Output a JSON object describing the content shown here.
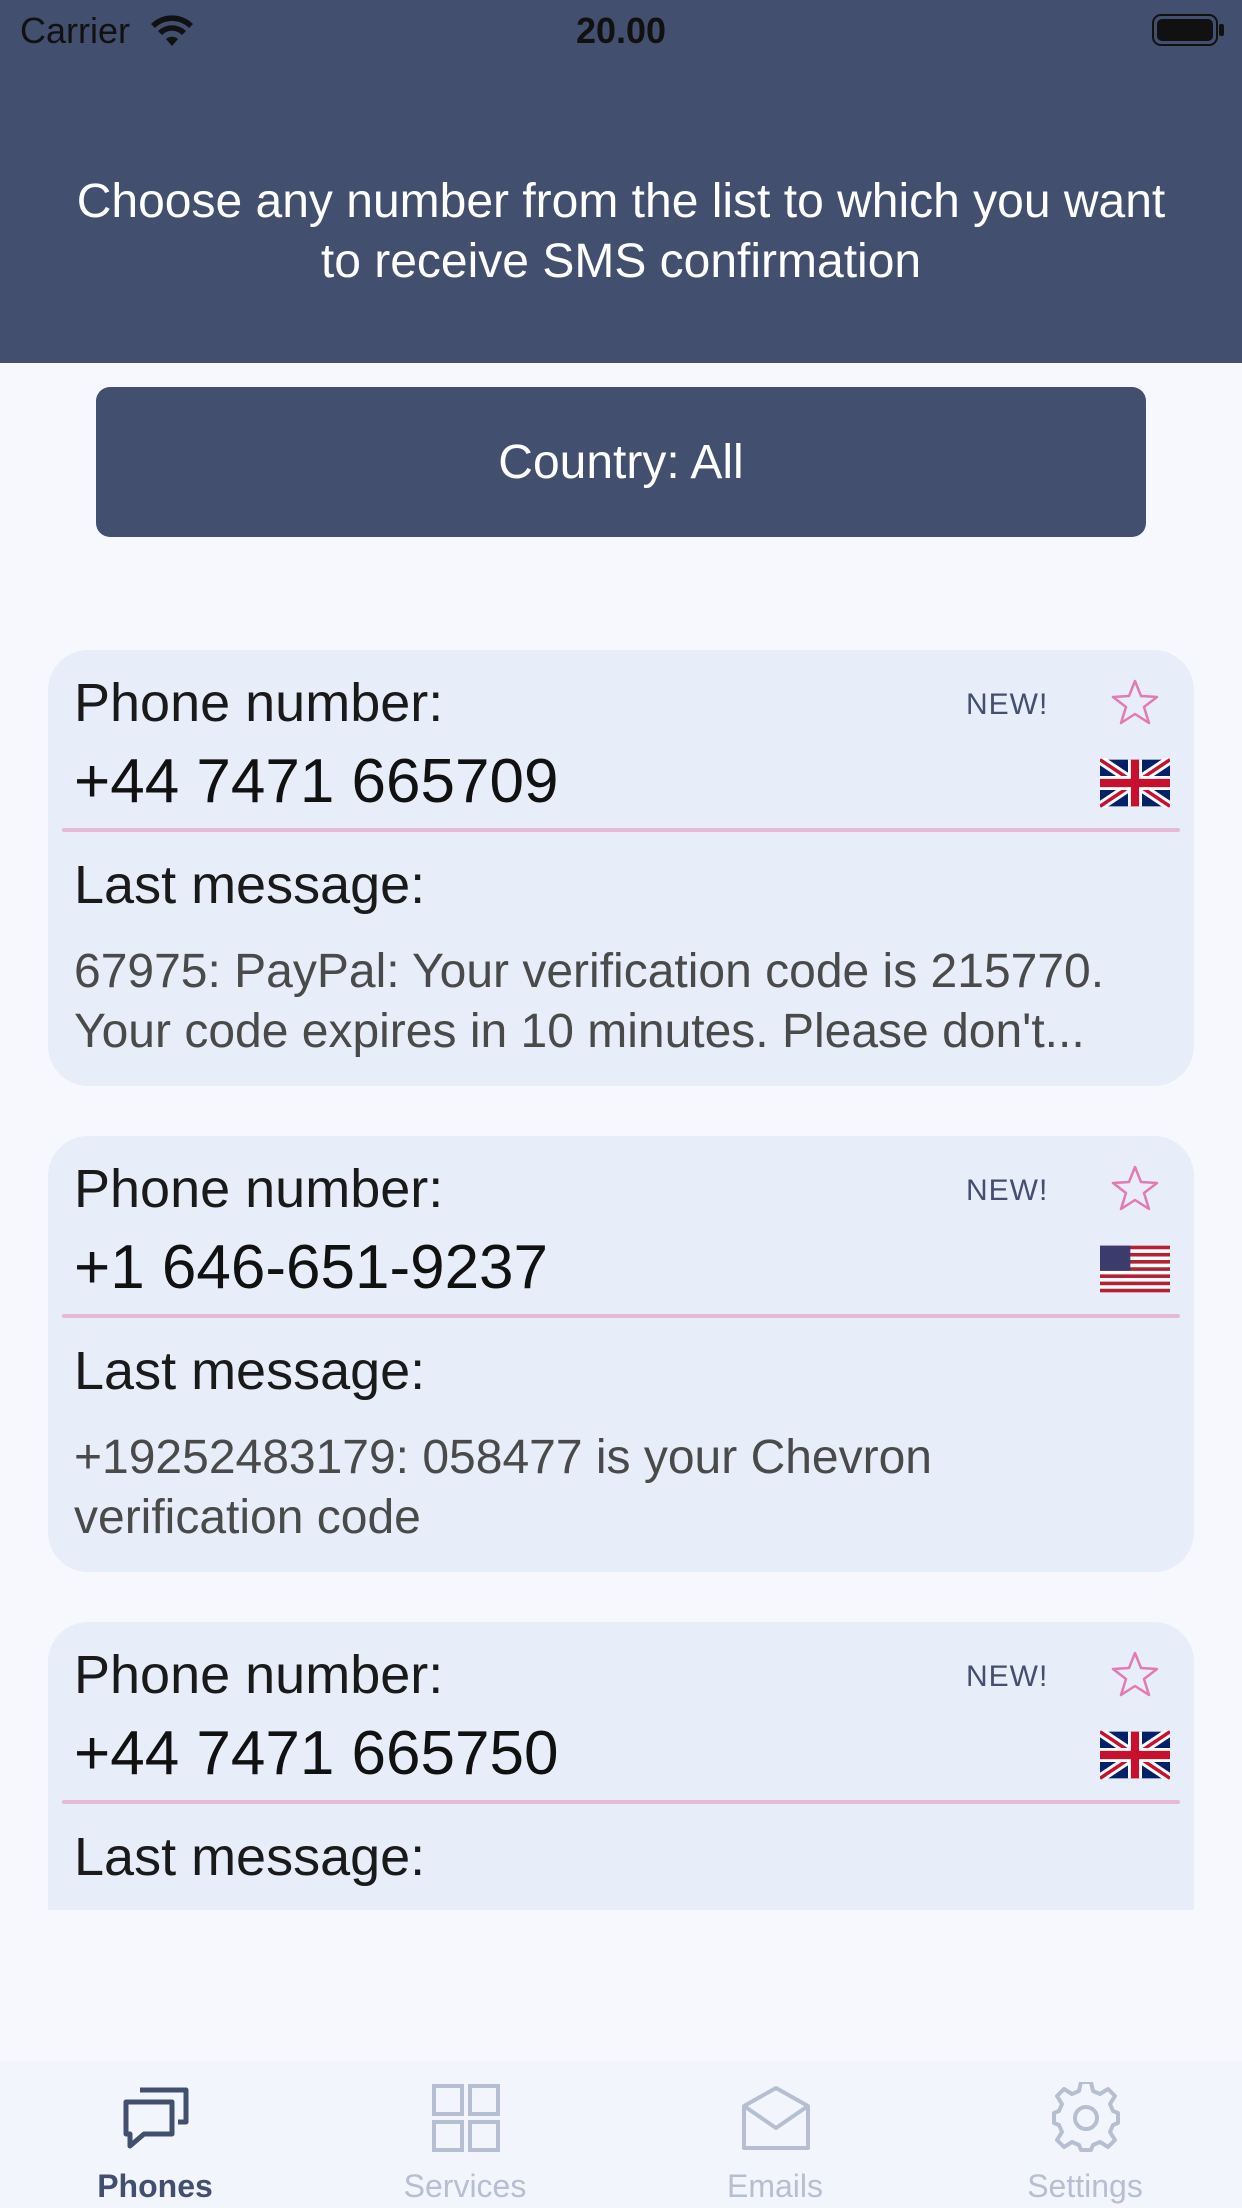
{
  "status_bar": {
    "carrier": "Carrier",
    "time": "20.00"
  },
  "header": {
    "title": "Choose any number from the list to which you want to receive SMS confirmation"
  },
  "filter": {
    "country_label": "Country: All"
  },
  "cards": [
    {
      "phone_label": "Phone number:",
      "phone": "+44 7471 665709",
      "badge": "NEW!",
      "flag": "uk-flag-icon",
      "message_label": "Last message:",
      "message": "67975: PayPal: Your verification code is 215770. Your code expires in 10 minutes. Please don't..."
    },
    {
      "phone_label": "Phone number:",
      "phone": "+1 646-651-9237",
      "badge": "NEW!",
      "flag": "us-flag-icon",
      "message_label": "Last message:",
      "message": "+19252483179: 058477 is your Chevron verification code"
    },
    {
      "phone_label": "Phone number:",
      "phone": "+44 7471 665750",
      "badge": "NEW!",
      "flag": "uk-flag-icon",
      "message_label": "Last message:",
      "message": ""
    }
  ],
  "tabs": [
    {
      "label": "Phones",
      "icon": "chat-bubbles-icon",
      "active": true
    },
    {
      "label": "Services",
      "icon": "grid-icon",
      "active": false
    },
    {
      "label": "Emails",
      "icon": "envelope-icon",
      "active": false
    },
    {
      "label": "Settings",
      "icon": "gear-icon",
      "active": false
    }
  ],
  "colors": {
    "accent": "#434f6f",
    "card": "#e7edf9",
    "divider": "#e6b9d6",
    "star": "#e27ab3",
    "inactive_tab": "#b6bfd1"
  }
}
